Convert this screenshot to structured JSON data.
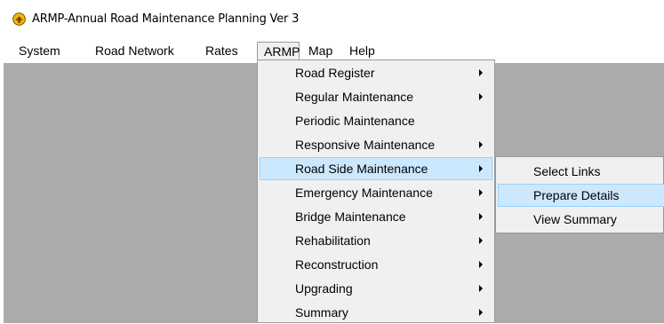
{
  "window": {
    "title": "ARMP-Annual Road Maintenance Planning Ver 3",
    "icon": "app-logo-icon"
  },
  "menubar": [
    {
      "label": "System"
    },
    {
      "label": "Road Network"
    },
    {
      "label": "Rates"
    },
    {
      "label": "ARMP"
    },
    {
      "label": "Map"
    },
    {
      "label": "Help"
    }
  ],
  "armp_menu": {
    "items": [
      {
        "label": "Road Register",
        "has_submenu": true
      },
      {
        "label": "Regular Maintenance",
        "has_submenu": true
      },
      {
        "label": "Periodic Maintenance",
        "has_submenu": false
      },
      {
        "label": "Responsive Maintenance",
        "has_submenu": true
      },
      {
        "label": "Road Side Maintenance",
        "has_submenu": true
      },
      {
        "label": "Emergency Maintenance",
        "has_submenu": true
      },
      {
        "label": "Bridge Maintenance",
        "has_submenu": true
      },
      {
        "label": "Rehabilitation",
        "has_submenu": true
      },
      {
        "label": "Reconstruction",
        "has_submenu": true
      },
      {
        "label": "Upgrading",
        "has_submenu": true
      },
      {
        "label": "Summary",
        "has_submenu": true
      }
    ],
    "highlighted": "Road Side Maintenance"
  },
  "roadside_submenu": {
    "items": [
      {
        "label": "Select Links"
      },
      {
        "label": "Prepare Details"
      },
      {
        "label": "View Summary"
      }
    ],
    "highlighted": "Prepare Details"
  },
  "colors": {
    "workspace": "#ababab",
    "menu_bg": "#f0f0f0",
    "highlight": "#cce8ff",
    "highlight_border": "#99d1ff"
  }
}
